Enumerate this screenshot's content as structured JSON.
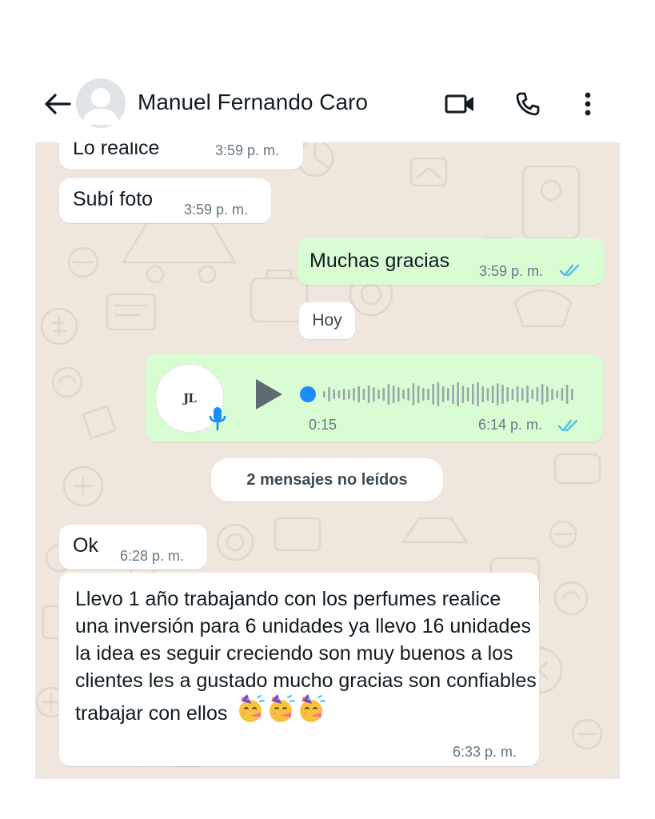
{
  "header": {
    "contact_name": "Manuel Fernando Caro",
    "icons": [
      "back-arrow-icon",
      "avatar-placeholder-icon",
      "video-call-icon",
      "phone-icon",
      "more-vertical-icon"
    ]
  },
  "messages": [
    {
      "direction": "in",
      "text": "Lo realice",
      "time": "3:59 p. m."
    },
    {
      "direction": "in",
      "text": "Subí foto",
      "time": "3:59 p. m."
    },
    {
      "direction": "out",
      "text": "Muchas gracias",
      "time": "3:59 p. m.",
      "status": "read"
    },
    {
      "direction": "out",
      "type": "voice",
      "logo_text": "JL",
      "duration": "0:15",
      "time": "6:14 p. m.",
      "status": "read",
      "progress": 0
    },
    {
      "direction": "in",
      "text": "Ok",
      "time": "6:28 p. m."
    },
    {
      "direction": "in",
      "text": "Llevo 1 año trabajando con los perfumes realice una inversión para 6 unidades ya llevo 16 unidades la idea es seguir creciendo son muy buenos a los clientes les a gustado mucho gracias son confiables trabajar con ellos",
      "emojis": "🥳🥳🥳",
      "time": "6:33 p. m."
    }
  ],
  "separators": {
    "date_label": "Hoy",
    "unread_label": "2 mensajes no leídos"
  },
  "colors": {
    "chat_background": "#efe7de",
    "incoming_bubble": "#ffffff",
    "outgoing_bubble": "#d9fdd3",
    "read_ticks": "#53bdeb",
    "timestamp": "#667781",
    "voice_accent": "#1b8dfb"
  }
}
